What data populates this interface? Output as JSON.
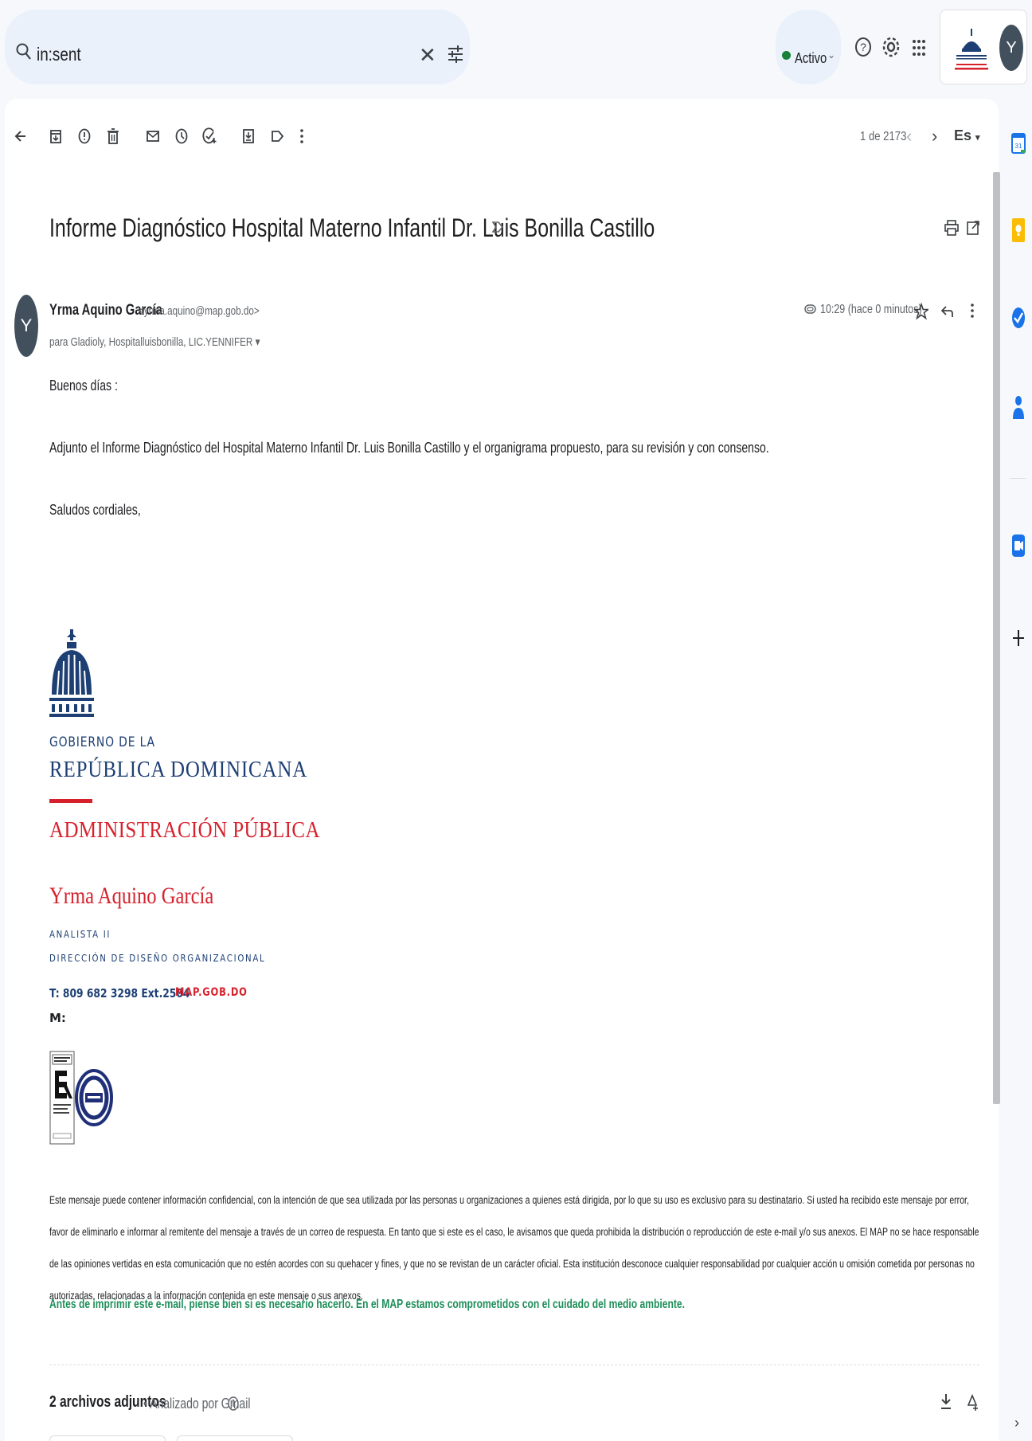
{
  "search": {
    "query": "in:sent"
  },
  "status": {
    "label": "Activo"
  },
  "account": {
    "avatar_letter": "Y"
  },
  "toolbar": {
    "pager": "1 de 2173",
    "lang": "Es"
  },
  "email": {
    "subject": "Informe Diagnóstico Hospital Materno Infantil Dr. Luis Bonilla Castillo",
    "sender_name": "Yrma Aquino García",
    "sender_email": "<yrma.aquino@map.gob.do>",
    "recipients": "para Gladioly, Hospitalluisbonilla, LIC.YENNIFER ▾",
    "time": "10:29 (hace 0 minutos)",
    "avatar_letter": "Y",
    "body": [
      "Buenos días :",
      "Adjunto el Informe Diagnóstico del Hospital Materno Infantil Dr. Luis Bonilla Castillo y el organigrama propuesto, para su revisión y con consenso.",
      "Saludos cordiales,"
    ]
  },
  "signature": {
    "gov_line1": "GOBIERNO DE LA",
    "gov_line2": "REPÚBLICA DOMINICANA",
    "gov_line3": "ADMINISTRACIÓN PÚBLICA",
    "name": "Yrma Aquino García",
    "role": "ANALISTA II",
    "department": "DIRECCIÓN DE DISEÑO ORGANIZACIONAL",
    "phone": "T: 809 682 3298 Ext.2504",
    "website": "MAP.GOB.DO",
    "mobile": "M:"
  },
  "disclaimer": "Este mensaje puede contener información confidencial, con la intención de que sea utilizada por las personas u organizaciones a quienes está dirigida, por lo que su uso es exclusivo para su destinatario. Si usted ha recibido este mensaje por error, favor de eliminarlo e informar al remitente del mensaje a través de un correo de respuesta. En tanto que si este es el caso, le avisamos que queda prohibida la distribución o reproducción de este e-mail y/o sus anexos. El MAP no se hace responsable de las opiniones vertidas en esta comunicación que no estén acordes con su quehacer y fines, y que no se revistan de un carácter oficial. Esta institución desconoce cualquier responsabilidad por cualquier acción u omisión cometida por personas no autorizadas, relacionadas a la información contenida en este mensaje o sus anexos.",
  "eco_note": "Antes de imprimir este e-mail, piense bien si es necesario hacerlo. En el MAP estamos comprometidos con el cuidado del medio ambiente.",
  "attachments": {
    "count_label": "2 archivos adjuntos",
    "scan_label": "• Analizado por Gmail"
  },
  "colors": {
    "gov_blue": "#1d3f74",
    "gov_red": "#d6212c",
    "eco_green": "#1e8e5a",
    "active_green": "#188038"
  },
  "icons": {
    "toolbar": [
      "back-arrow-icon",
      "archive-icon",
      "report-spam-icon",
      "delete-icon",
      "mark-unread-icon",
      "snooze-icon",
      "add-task-icon",
      "move-to-icon",
      "label-icon",
      "more-vert-icon"
    ],
    "side_panel": [
      "calendar-icon",
      "keep-icon",
      "tasks-icon",
      "contacts-icon",
      "meet-icon",
      "add-icon"
    ]
  }
}
